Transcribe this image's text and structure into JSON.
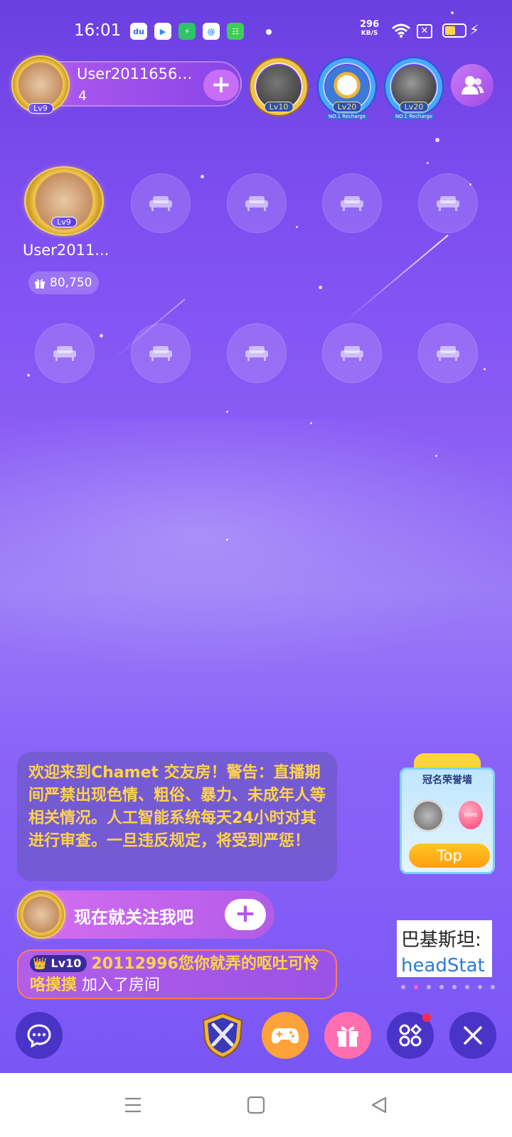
{
  "status_bar": {
    "time": "16:01",
    "net_speed": "296",
    "net_unit": "KB/S",
    "battery_color": "#ffd84a"
  },
  "header": {
    "host_name": "User20116564...",
    "host_count": "4",
    "host_level": "Lv9",
    "viewers": [
      {
        "level": "Lv10",
        "banner": ""
      },
      {
        "level": "Lv20",
        "banner": "NO.1 Recharge"
      },
      {
        "level": "Lv20",
        "banner": "NO.1 Recharge"
      }
    ]
  },
  "seats": {
    "seat1_name": "User2011...",
    "seat1_level": "Lv9",
    "seat1_gifts": "80,750"
  },
  "chat": {
    "notice": "欢迎来到Chamet 交友房！警告：直播期间严禁出现色情、粗俗、暴力、未成年人等相关情况。人工智能系统每天24小时对其进行审查。一旦违反规定，将受到严惩！",
    "follow_prompt": "现在就关注我吧",
    "join_level": "Lv10",
    "join_name": "20112996您你就弄的呕吐可怜咯摸摸",
    "join_action": " 加入了房间"
  },
  "widgets": {
    "honor_title": "冠名荣誉墙",
    "honor_button": "Top",
    "ticker_line1": "巴基斯坦:",
    "ticker_line2": "headStat"
  },
  "colors": {
    "accent_purple": "#8a5cf5",
    "notice_text": "#ffd34a",
    "gift_button": "#ff6fb0",
    "game_button": "#ffa23a",
    "close_button": "#4a34c8"
  }
}
